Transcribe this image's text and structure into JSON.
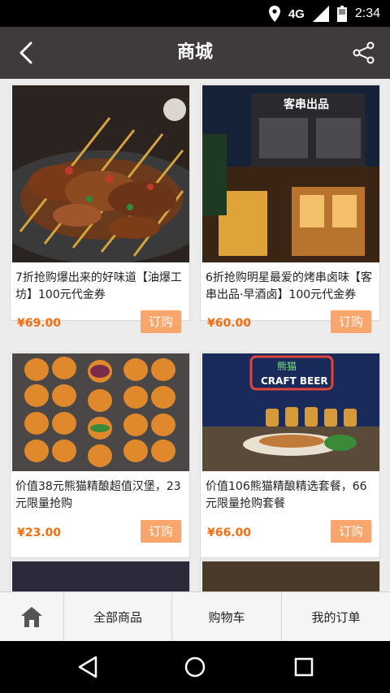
{
  "status_bar": {
    "network": "4G",
    "time": "2:34",
    "icons": [
      "location-icon",
      "signal-icon",
      "battery-icon"
    ]
  },
  "header": {
    "title": "商城",
    "back_icon": "back-arrow-icon",
    "share_icon": "share-icon"
  },
  "products": [
    {
      "title": "7折抢购爆出来的好味道【油爆工坊】100元代金券",
      "price": "¥69.00",
      "buy_label": "订购"
    },
    {
      "title": "6折抢购明星最爱的烤串卤味【客串出品·早酒卤】100元代金券",
      "price": "¥60.00",
      "buy_label": "订购"
    },
    {
      "title": "价值38元熊猫精酿超值汉堡，23元限量抢购",
      "price": "¥23.00",
      "buy_label": "订购"
    },
    {
      "title": "价值106熊猫精酿精选套餐，66元限量抢购套餐",
      "price": "¥66.00",
      "buy_label": "订购"
    }
  ],
  "image_signs": {
    "shop_sign": "客串出品",
    "neon_line1": "熊猫",
    "neon_line2": "CRAFT BEER"
  },
  "bottom_nav": {
    "home_icon": "home-icon",
    "all_products": "全部商品",
    "cart": "购物车",
    "my_orders": "我的订单"
  },
  "colors": {
    "header_bg": "#3f3b3a",
    "price": "#f36d11",
    "buy_button": "#f9a66d"
  }
}
